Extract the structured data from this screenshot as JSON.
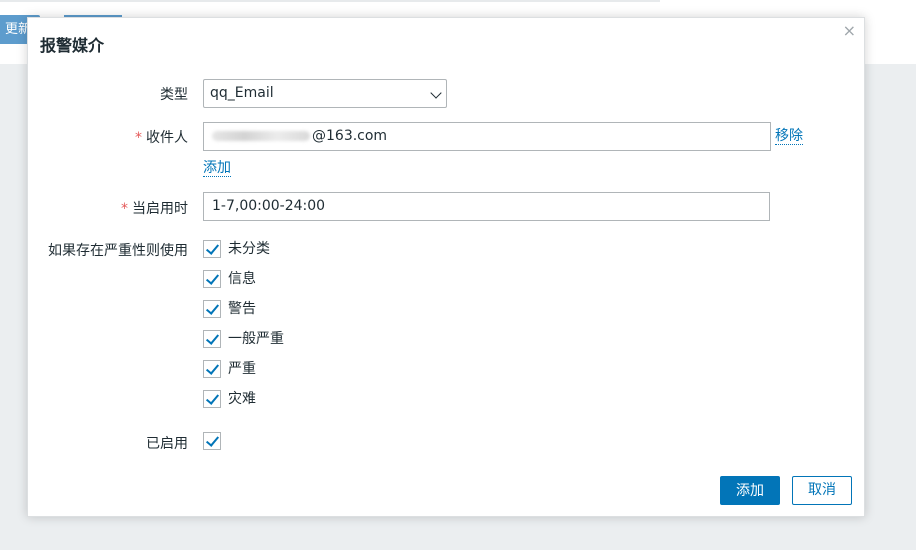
{
  "background": {
    "button_label": "更新"
  },
  "dialog": {
    "title": "报警媒介",
    "close_glyph": "×",
    "type_label": "类型",
    "type_value": "qq_Email",
    "recipient_label": "收件人",
    "required_mark": "*",
    "recipient_value": "@163.com",
    "remove_link": "移除",
    "add_link": "添加",
    "when_active_label": "当启用时",
    "when_active_value": "1-7,00:00-24:00",
    "severity_label": "如果存在严重性则使用",
    "severities": [
      "未分类",
      "信息",
      "警告",
      "一般严重",
      "严重",
      "灾难"
    ],
    "enabled_label": "已启用",
    "add_button": "添加",
    "cancel_button": "取消"
  },
  "colors": {
    "accent": "#0275b8",
    "required": "#e45959"
  }
}
